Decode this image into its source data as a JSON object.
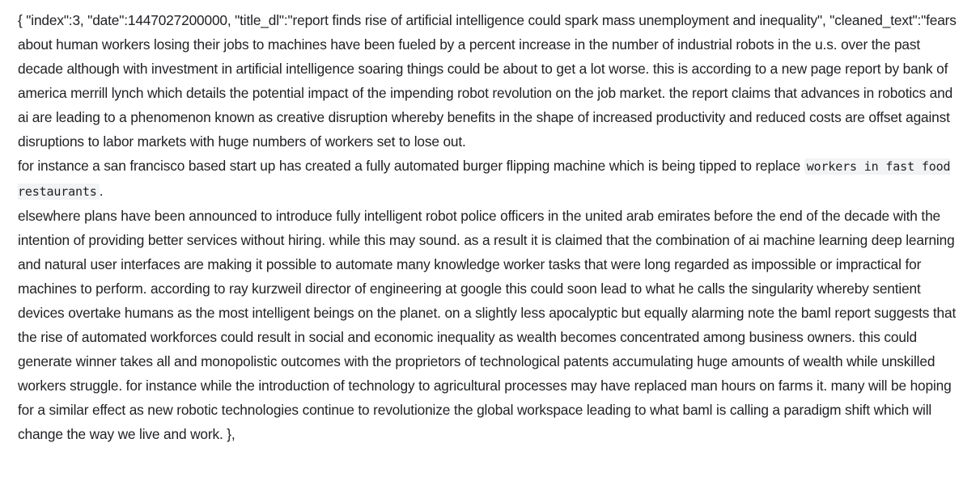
{
  "document": {
    "para1": "{ \"index\":3, \"date\":1447027200000, \"title_dl\":\"report finds rise of artificial intelligence could spark mass unemployment and inequality\", \"cleaned_text\":\"fears about human workers losing their jobs to machines have been fueled by a percent increase in the number of industrial robots in the u.s. over the past decade although with investment in artificial intelligence soaring things could be about to get a lot worse. this is according to a new page report by bank of america merrill lynch which details the potential impact of the impending robot revolution on the job market. the report claims that advances in robotics and ai are leading to a phenomenon known as creative disruption whereby benefits in the shape of increased productivity and reduced costs are offset against disruptions to labor markets with huge numbers of workers set to lose out.",
    "para2_text": "for instance a san francisco based start up has created a fully automated burger flipping machine which is being tipped to replace ",
    "para2_code": "workers in fast food restaurants",
    "para2_end": ".",
    "para3": "elsewhere plans have been announced to introduce fully intelligent robot police officers in the united arab emirates before the end of the decade with the intention of providing better services without hiring. while this may sound. as a result it is claimed that the combination of ai machine learning deep learning and natural user interfaces are making it possible to automate many knowledge worker tasks that were long regarded as impossible or impractical for machines to perform. according to ray kurzweil director of engineering at google this could soon lead to what he calls the singularity whereby sentient devices overtake humans as the most intelligent beings on the planet. on a slightly less apocalyptic but equally alarming note the baml report suggests that the rise of automated workforces could result in social and economic inequality as wealth becomes concentrated among business owners. this could generate winner takes all and monopolistic outcomes with the proprietors of technological patents accumulating huge amounts of wealth while unskilled workers struggle. for instance while the introduction of technology to agricultural processes may have replaced man hours on farms it. many will be hoping for a similar effect as new robotic technologies continue to revolutionize the global workspace leading to what baml is calling a paradigm shift which will change the way we live and work. },"
  }
}
